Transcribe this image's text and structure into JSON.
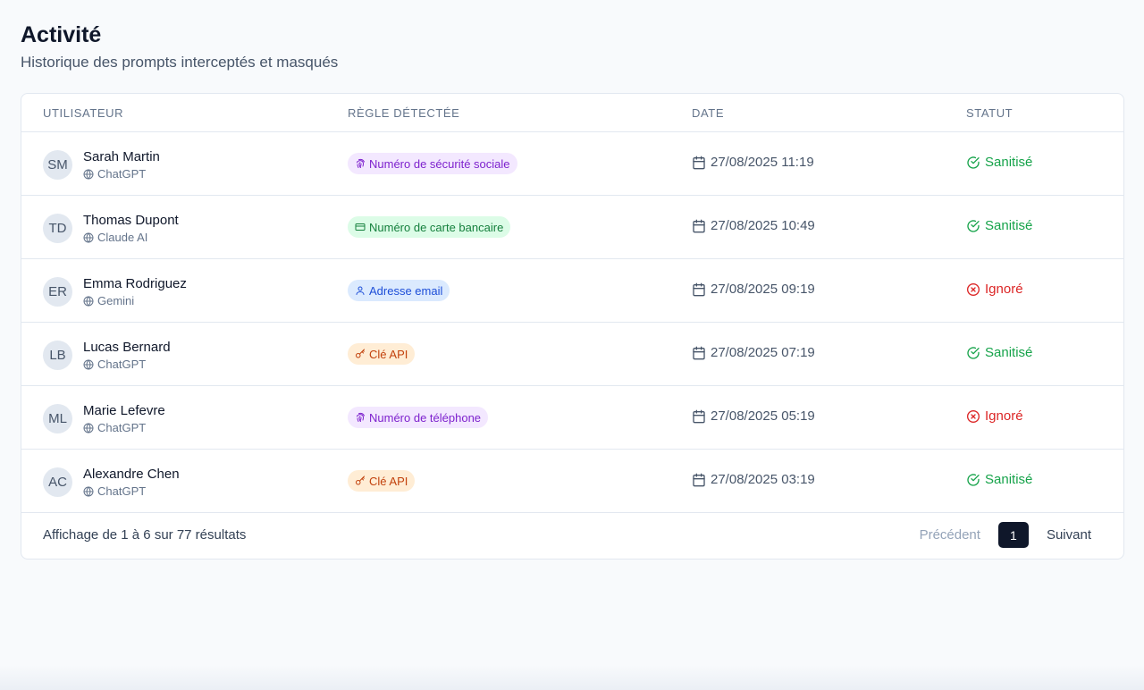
{
  "header": {
    "title": "Activité",
    "subtitle": "Historique des prompts interceptés et masqués"
  },
  "table": {
    "columns": [
      "UTILISATEUR",
      "RÈGLE DÉTECTÉE",
      "DATE",
      "STATUT"
    ],
    "rows": [
      {
        "initials": "SM",
        "name": "Sarah Martin",
        "app": "ChatGPT",
        "rule": "Numéro de sécurité sociale",
        "rule_icon": "fingerprint-icon",
        "rule_color": "#7e22ce",
        "date": "27/08/2025 11:19",
        "status": "Sanitisé",
        "status_icon": "check-circle-icon"
      },
      {
        "initials": "TD",
        "name": "Thomas Dupont",
        "app": "Claude AI",
        "rule": "Numéro de carte bancaire",
        "rule_icon": "credit-card-icon",
        "rule_color": "#15803d",
        "date": "27/08/2025 10:49",
        "status": "Sanitisé",
        "status_icon": "check-circle-icon"
      },
      {
        "initials": "ER",
        "name": "Emma Rodriguez",
        "app": "Gemini",
        "rule": "Adresse email",
        "rule_icon": "user-icon",
        "rule_color": "#1d4ed8",
        "date": "27/08/2025 09:19",
        "status": "Ignoré",
        "status_icon": "x-circle-icon"
      },
      {
        "initials": "LB",
        "name": "Lucas Bernard",
        "app": "ChatGPT",
        "rule": "Clé API",
        "rule_icon": "key-icon",
        "rule_color": "#c2410c",
        "date": "27/08/2025 07:19",
        "status": "Sanitisé",
        "status_icon": "check-circle-icon"
      },
      {
        "initials": "ML",
        "name": "Marie Lefevre",
        "app": "ChatGPT",
        "rule": "Numéro de téléphone",
        "rule_icon": "fingerprint-icon",
        "rule_color": "#7e22ce",
        "date": "27/08/2025 05:19",
        "status": "Ignoré",
        "status_icon": "x-circle-icon"
      },
      {
        "initials": "AC",
        "name": "Alexandre Chen",
        "app": "ChatGPT",
        "rule": "Clé API",
        "rule_icon": "key-icon",
        "rule_color": "#c2410c",
        "date": "27/08/2025 03:19",
        "status": "Sanitisé",
        "status_icon": "check-circle-icon"
      }
    ]
  },
  "footer": {
    "results_text": "Affichage de 1 à 6 sur 77 résultats",
    "prev_label": "Précédent",
    "current_page": "1",
    "next_label": "Suivant"
  },
  "colors": {
    "sanitized": "#16a34a",
    "ignored": "#dc2626",
    "primary": "#0f172a"
  }
}
